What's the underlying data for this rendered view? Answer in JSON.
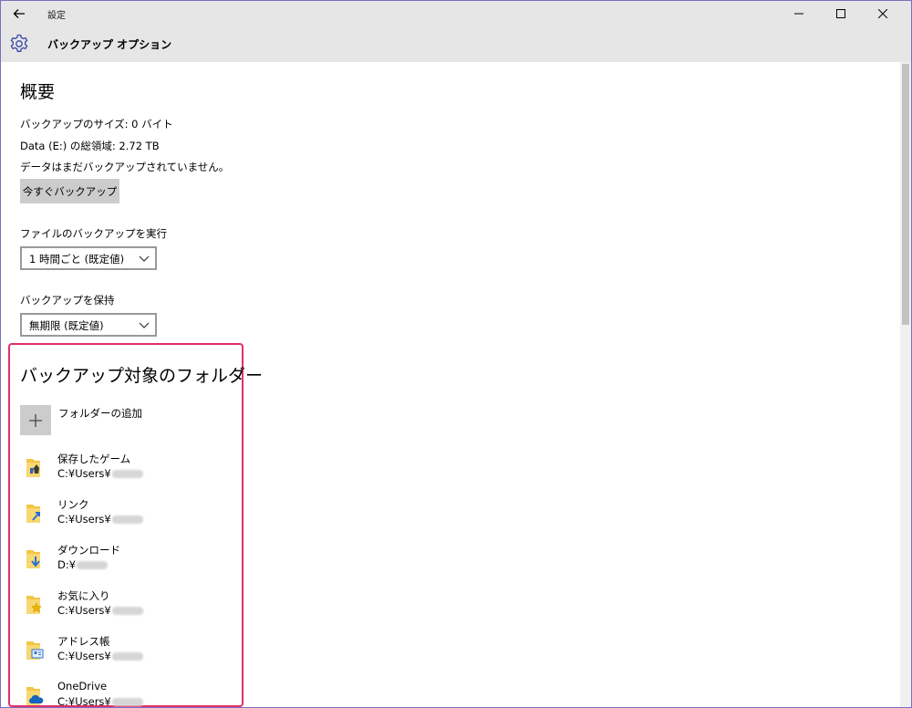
{
  "window": {
    "app_title": "設定",
    "page_title": "バックアップ オプション"
  },
  "overview": {
    "heading": "概要",
    "backup_size": "バックアップのサイズ: 0 バイト",
    "total_space": "Data (E:) の総領域: 2.72 TB",
    "status": "データはまだバックアップされていません。",
    "backup_now_label": "今すぐバックアップ"
  },
  "frequency": {
    "label": "ファイルのバックアップを実行",
    "selected": "1 時間ごと (既定値)"
  },
  "retention": {
    "label": "バックアップを保持",
    "selected": "無期限 (既定値)"
  },
  "folders": {
    "heading": "バックアップ対象のフォルダー",
    "add_label": "フォルダーの追加",
    "items": [
      {
        "name": "保存したゲーム",
        "path": "C:¥Users¥",
        "icon": "saved-games-folder-icon"
      },
      {
        "name": "リンク",
        "path": "C:¥Users¥",
        "icon": "links-folder-icon"
      },
      {
        "name": "ダウンロード",
        "path": "D:¥",
        "icon": "downloads-folder-icon"
      },
      {
        "name": "お気に入り",
        "path": "C:¥Users¥",
        "icon": "favorites-folder-icon"
      },
      {
        "name": "アドレス帳",
        "path": "C:¥Users¥",
        "icon": "contacts-folder-icon"
      },
      {
        "name": "OneDrive",
        "path": "C:¥Users¥",
        "icon": "onedrive-folder-icon"
      }
    ]
  },
  "colors": {
    "accent": "#3a46a8",
    "highlight": "#e0306a",
    "titlebar": "#e6e6e6",
    "button": "#cccccc",
    "folder": "#f3c546"
  }
}
